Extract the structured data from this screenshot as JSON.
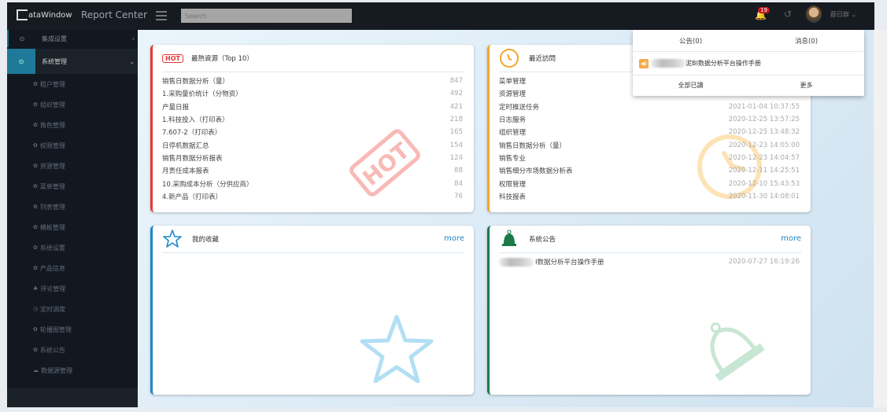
{
  "header": {
    "logo": "ataWindow",
    "app_title": "Report Center",
    "search_placeholder": "Search",
    "notification_count": "19",
    "user_name": "薛日群"
  },
  "sidebar": {
    "groups": [
      {
        "label": "集成设置",
        "expanded": false
      },
      {
        "label": "系统管理",
        "expanded": true
      }
    ],
    "items": [
      {
        "icon": "gear",
        "label": "租户管理"
      },
      {
        "icon": "gear",
        "label": "组织管理"
      },
      {
        "icon": "gear",
        "label": "角色管理"
      },
      {
        "icon": "gear",
        "label": "权限管理"
      },
      {
        "icon": "gear",
        "label": "资源管理"
      },
      {
        "icon": "gear",
        "label": "菜单管理"
      },
      {
        "icon": "gear",
        "label": "列表管理"
      },
      {
        "icon": "gear",
        "label": "模板管理"
      },
      {
        "icon": "gear",
        "label": "系统设置"
      },
      {
        "icon": "gear",
        "label": "产品信息"
      },
      {
        "icon": "sitemap",
        "label": "评论管理"
      },
      {
        "icon": "clock",
        "label": "定时调度"
      },
      {
        "icon": "gear",
        "label": "轮播图管理"
      },
      {
        "icon": "gear",
        "label": "系统公告"
      },
      {
        "icon": "cloud",
        "label": "数据源管理"
      }
    ]
  },
  "hot": {
    "badge": "HOT",
    "title": "最熱資源（Top 10）",
    "watermark": "HOT",
    "color": "#e53935",
    "rows": [
      {
        "name": "销售日数据分析（量）",
        "count": "847"
      },
      {
        "name": "1.采购量价统计（分物资）",
        "count": "492"
      },
      {
        "name": "产量日报",
        "count": "421"
      },
      {
        "name": "1.科技投入（打印表）",
        "count": "218"
      },
      {
        "name": "7.607-2（打印表）",
        "count": "165"
      },
      {
        "name": "日停机数据汇总",
        "count": "154"
      },
      {
        "name": "销售月数据分析报表",
        "count": "124"
      },
      {
        "name": "月责任成本报表",
        "count": "88"
      },
      {
        "name": "10.采购成本分析（分供应商）",
        "count": "84"
      },
      {
        "name": "4.新产品（打印表）",
        "count": "76"
      }
    ]
  },
  "recent": {
    "title": "最近訪問",
    "color": "#f5a623",
    "rows": [
      {
        "name": "菜单管理",
        "time": ""
      },
      {
        "name": "资源管理",
        "time": ""
      },
      {
        "name": "定时推送任务",
        "time": "2021-01-04 10:37:55"
      },
      {
        "name": "日志服务",
        "time": "2020-12-25 13:57:25"
      },
      {
        "name": "组织管理",
        "time": "2020-12-25 13:48:32"
      },
      {
        "name": "销售日数据分析（量）",
        "time": "2020-12-23 14:05:00"
      },
      {
        "name": "销售专业",
        "time": "2020-12-23 14:04:57"
      },
      {
        "name": "销售细分市场数据分析表",
        "time": "2020-12-11 14:25:51"
      },
      {
        "name": "权限管理",
        "time": "2020-12-10 15:43:53"
      },
      {
        "name": "科技报表",
        "time": "2020-11-30 14:08:01"
      }
    ]
  },
  "favorites": {
    "title": "我的收藏",
    "more": "more",
    "color": "#1e88c8"
  },
  "announcements": {
    "title": "系統公告",
    "more": "more",
    "color": "#1b7a4a",
    "rows": [
      {
        "name": "I数据分析平台操作手册",
        "time": "2020-07-27 16:19:26"
      }
    ]
  },
  "dropdown": {
    "tab_notice": "公告(0)",
    "tab_message": "消息(0)",
    "message": "泥BI数据分析平台操作手册",
    "mark_all_read": "全部已讀",
    "more": "更多"
  }
}
